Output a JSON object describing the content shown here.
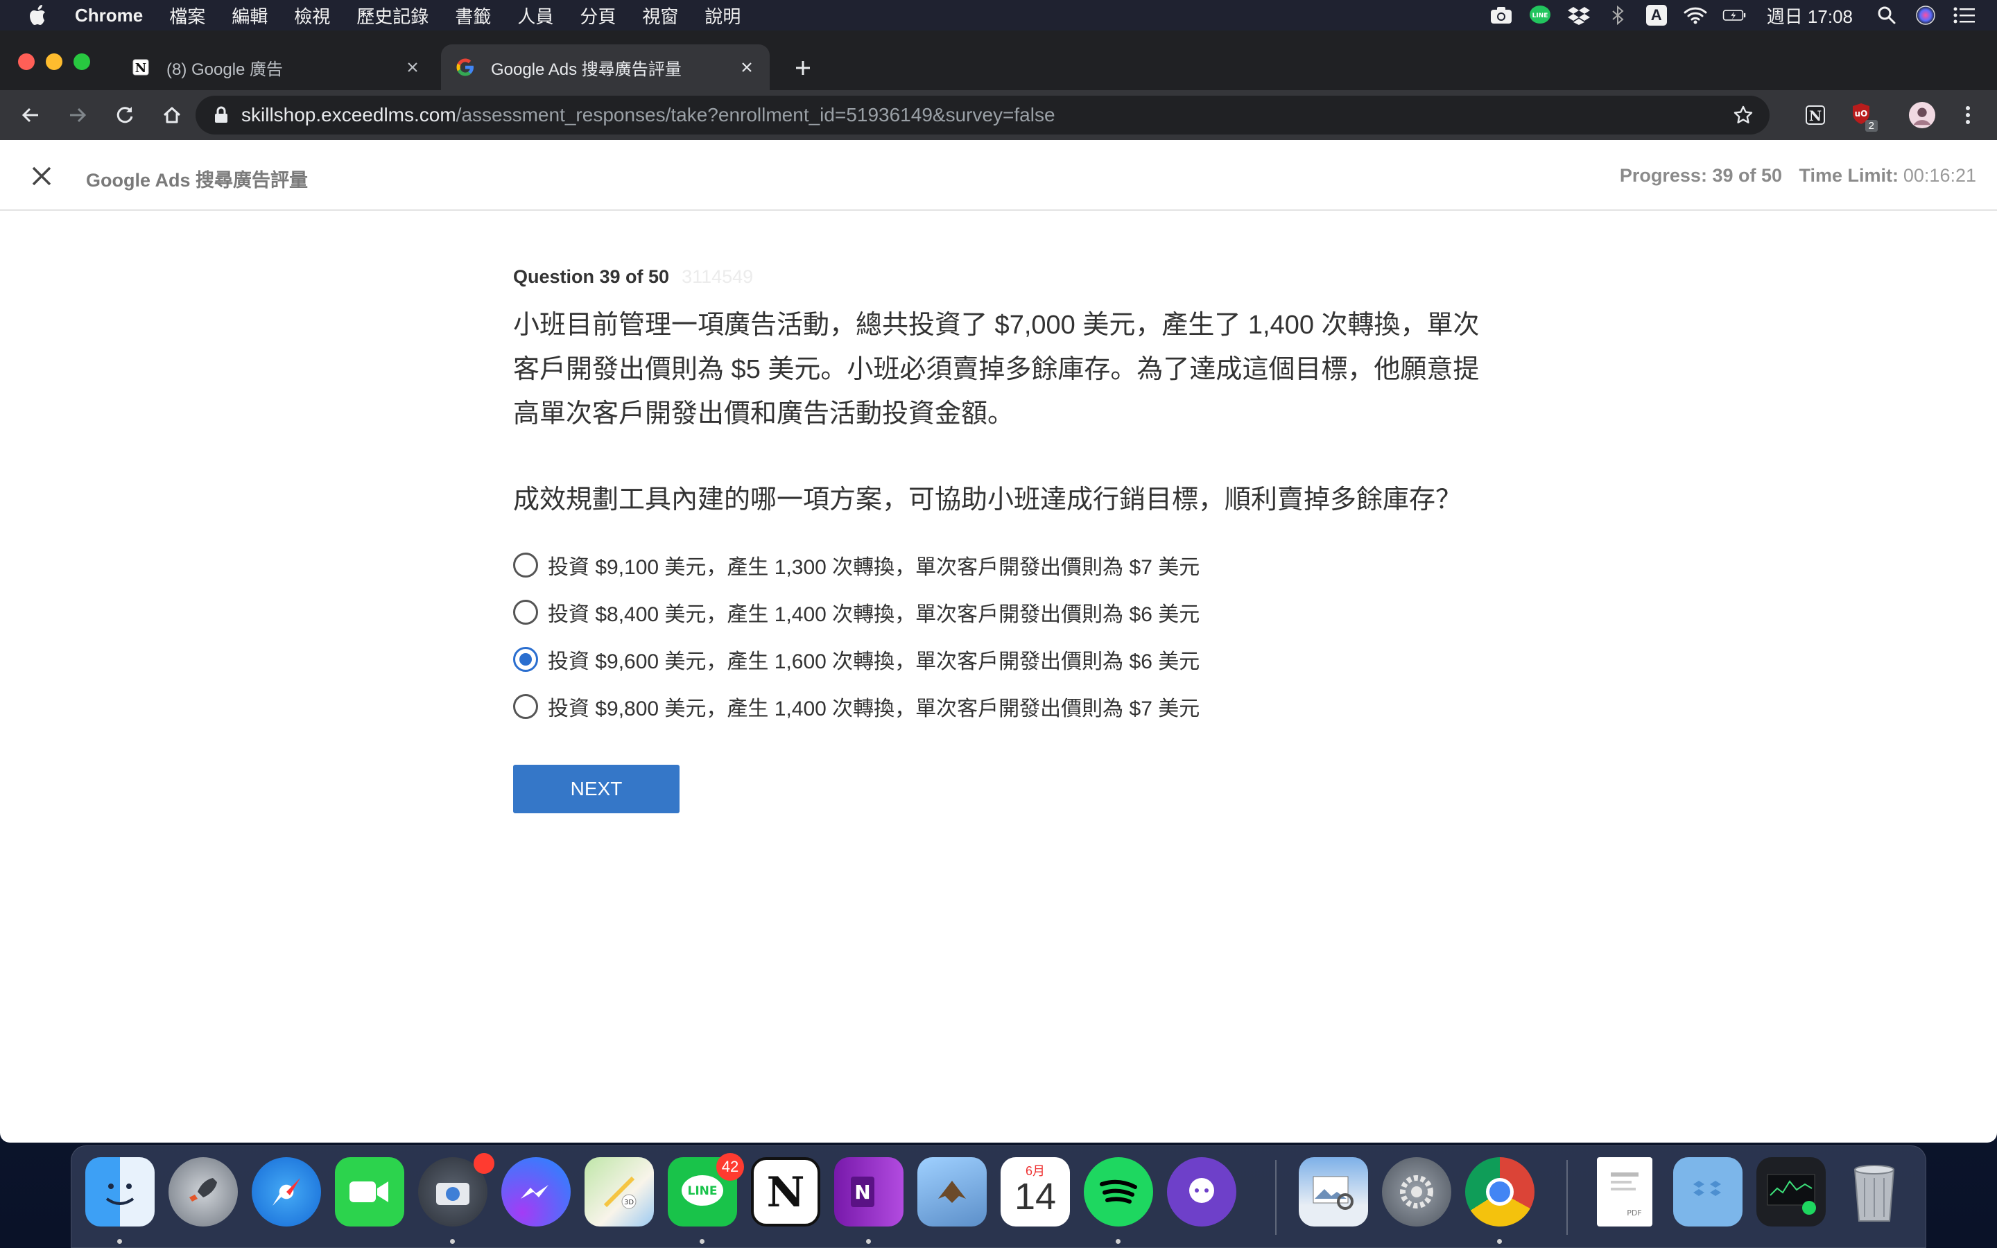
{
  "menubar": {
    "app": "Chrome",
    "items": [
      "檔案",
      "編輯",
      "檢視",
      "歷史記錄",
      "書籤",
      "人員",
      "分頁",
      "視窗",
      "說明"
    ],
    "clock": "週日 17:08",
    "status_icons": [
      "camera-icon",
      "line-icon",
      "dropbox-icon",
      "bluetooth-icon",
      "input-method-icon",
      "wifi-icon",
      "battery-icon",
      "search-icon",
      "siri-icon",
      "control-center-icon"
    ],
    "input_method_label": "A"
  },
  "browser": {
    "tabs": [
      {
        "title": "(8) Google 廣告",
        "icon": "notion-icon",
        "active": false
      },
      {
        "title": "Google Ads 搜尋廣告評量",
        "icon": "google-icon",
        "active": true
      }
    ],
    "url_host": "skillshop.exceedlms.com",
    "url_path": "/assessment_responses/take?enrollment_id=51936149&survey=false",
    "extension_badge": "2"
  },
  "page": {
    "course_title": "Google Ads 搜尋廣告評量",
    "progress": "Progress: 39 of 50",
    "time_limit_label": "Time Limit:",
    "time_value": "00:16:21"
  },
  "question": {
    "number": "Question 39 of 50",
    "id": "3114549",
    "body": "小班目前管理一項廣告活動，總共投資了 $7,000 美元，產生了 1,400 次轉換，單次客戶開發出價則為 $5 美元。小班必須賣掉多餘庫存。為了達成這個目標，他願意提高單次客戶開發出價和廣告活動投資金額。",
    "prompt": "成效規劃工具內建的哪一項方案，可協助小班達成行銷目標，順利賣掉多餘庫存？",
    "options": [
      {
        "label": "投資 $9,100 美元，產生 1,300 次轉換，單次客戶開發出價則為 $7 美元",
        "selected": false
      },
      {
        "label": "投資 $8,400 美元，產生 1,400 次轉換，單次客戶開發出價則為 $6 美元",
        "selected": false
      },
      {
        "label": "投資 $9,600 美元，產生 1,600 次轉換，單次客戶開發出價則為 $6 美元",
        "selected": true
      },
      {
        "label": "投資 $9,800 美元，產生 1,400 次轉換，單次客戶開發出價則為 $7 美元",
        "selected": false
      }
    ],
    "next_label": "NEXT",
    "accent_color": "#3577c8"
  },
  "dock": {
    "line_badge": "42",
    "calendar_month": "6月",
    "calendar_day": "14",
    "apps": [
      "finder-icon",
      "launchpad-icon",
      "safari-icon",
      "facetime-icon",
      "screenshot-icon",
      "messenger-icon",
      "maps-icon",
      "line-icon",
      "notion-icon",
      "onenote-icon",
      "mail-icon",
      "calendar-icon",
      "spotify-icon",
      "github-desktop-icon",
      "preview-icon",
      "system-preferences-icon",
      "chrome-icon",
      "pdf-document-icon",
      "dropbox-folder-icon",
      "activity-monitor-icon",
      "trash-icon"
    ]
  }
}
